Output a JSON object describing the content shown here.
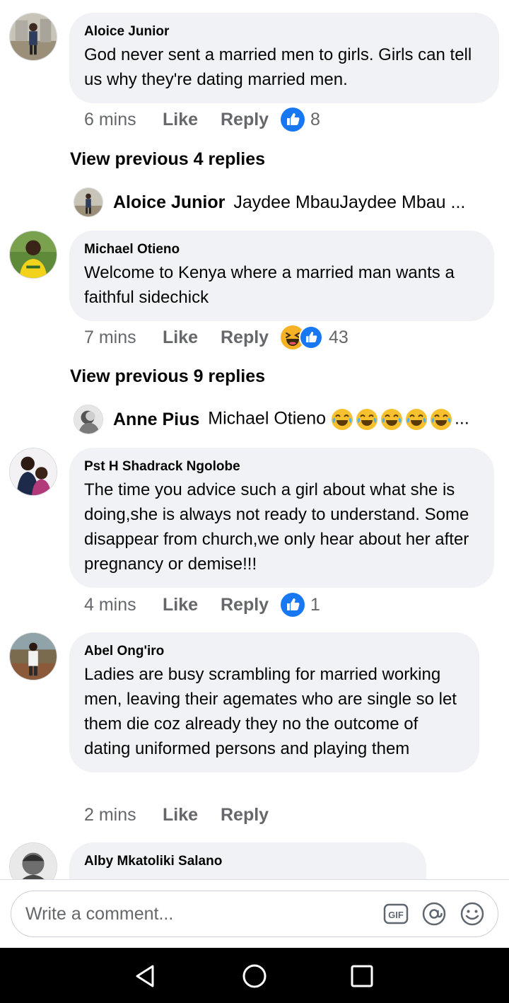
{
  "comments": [
    {
      "author": "Aloice Junior",
      "text": "God never sent a married men to girls. Girls can tell us why they're dating married men.",
      "time": "6 mins",
      "like_label": "Like",
      "reply_label": "Reply",
      "reactions": [
        "like-reaction-icon"
      ],
      "reaction_count": "8",
      "view_previous": "View previous 4 replies",
      "latest_reply": {
        "author": "Aloice Junior",
        "text": "Jaydee MbauJaydee Mbau ..."
      }
    },
    {
      "author": "Michael Otieno",
      "text": "Welcome to Kenya where a married man wants a faithful sidechick",
      "time": "7 mins",
      "like_label": "Like",
      "reply_label": "Reply",
      "reactions": [
        "haha-reaction-icon",
        "like-reaction-icon"
      ],
      "reaction_count": "43",
      "view_previous": "View previous 9 replies",
      "latest_reply": {
        "author": "Anne Pius",
        "text": "Michael Otieno",
        "emoji_count": 5,
        "emoji": "tears-of-joy-emoji",
        "trailing": "..."
      }
    },
    {
      "author": "Pst H Shadrack Ngolobe",
      "text": "The time you advice such a girl about what she is doing,she is always not ready to understand. Some disappear from church,we only hear about her after pregnancy or demise!!!",
      "time": "4 mins",
      "like_label": "Like",
      "reply_label": "Reply",
      "reactions": [
        "like-reaction-icon"
      ],
      "reaction_count": "1"
    },
    {
      "author": "Abel Ong'iro",
      "text": "Ladies are busy scrambling for married working men, leaving their agemates who are single so let them die coz already they no the outcome of dating uniformed persons and playing them",
      "time": "2 mins",
      "like_label": "Like",
      "reply_label": "Reply"
    },
    {
      "author": "Alby Mkatoliki Salano"
    }
  ],
  "composer": {
    "placeholder": "Write a comment...",
    "icons": [
      "gif-icon",
      "mention-icon",
      "emoji-icon"
    ]
  },
  "navigation": {
    "icons": [
      "back-icon",
      "home-icon",
      "recents-icon"
    ]
  },
  "colors": {
    "bubble": "#f0f2f5",
    "meta_text": "#65676b",
    "like_blue": "#1877f2",
    "haha_yellow": "#f7b125"
  }
}
